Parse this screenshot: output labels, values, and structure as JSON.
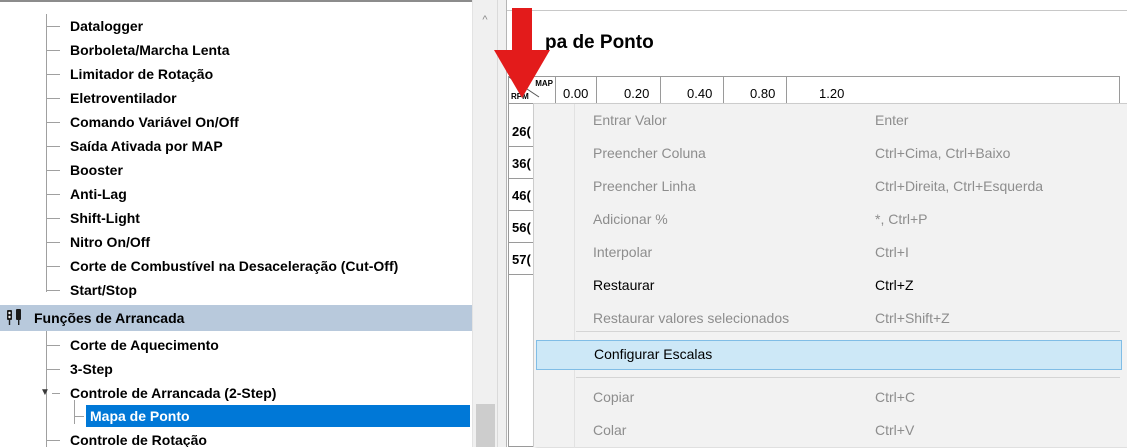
{
  "tree": {
    "items": [
      {
        "label": "Datalogger"
      },
      {
        "label": "Borboleta/Marcha Lenta"
      },
      {
        "label": "Limitador de Rotação"
      },
      {
        "label": "Eletroventilador"
      },
      {
        "label": "Comando Variável On/Off"
      },
      {
        "label": "Saída Ativada por MAP"
      },
      {
        "label": "Booster"
      },
      {
        "label": "Anti-Lag"
      },
      {
        "label": "Shift-Light"
      },
      {
        "label": "Nitro On/Off"
      },
      {
        "label": "Corte de Combustível na Desaceleração (Cut-Off)"
      },
      {
        "label": "Start/Stop"
      }
    ],
    "group": {
      "label": "Funções de Arrancada"
    },
    "group_items": [
      {
        "label": "Corte de Aquecimento"
      },
      {
        "label": "3-Step"
      },
      {
        "label": "Controle de Arrancada (2-Step)"
      },
      {
        "label": "Mapa de Ponto"
      },
      {
        "label": "Controle de Rotação"
      }
    ],
    "expander_icon": "chevron-down-icon",
    "scroll_up_glyph": "^"
  },
  "content": {
    "title": "pa de Ponto",
    "grid": {
      "corner_top": "MAP",
      "corner_left": "RPM",
      "columns": [
        "0.00",
        "0.20",
        "0.40",
        "0.80",
        "1.20"
      ],
      "rows": [
        "26(",
        "36(",
        "46(",
        "56(",
        "57("
      ]
    }
  },
  "annotation": {
    "arrow_color": "#e31b1b"
  },
  "context_menu": {
    "items": [
      {
        "label": "Entrar Valor",
        "shortcut": "Enter",
        "enabled": false
      },
      {
        "label": "Preencher Coluna",
        "shortcut": "Ctrl+Cima, Ctrl+Baixo",
        "enabled": false
      },
      {
        "label": "Preencher Linha",
        "shortcut": "Ctrl+Direita, Ctrl+Esquerda",
        "enabled": false
      },
      {
        "label": "Adicionar %",
        "shortcut": "*, Ctrl+P",
        "enabled": false
      },
      {
        "label": "Interpolar",
        "shortcut": "Ctrl+I",
        "enabled": false
      },
      {
        "label": "Restaurar",
        "shortcut": "Ctrl+Z",
        "enabled": true
      },
      {
        "label": "Restaurar valores selecionados",
        "shortcut": "Ctrl+Shift+Z",
        "enabled": false
      },
      {
        "label": "Configurar Escalas",
        "shortcut": "",
        "enabled": true,
        "highlighted": true
      },
      {
        "label": "Copiar",
        "shortcut": "Ctrl+C",
        "enabled": false
      },
      {
        "label": "Colar",
        "shortcut": "Ctrl+V",
        "enabled": false
      }
    ]
  }
}
